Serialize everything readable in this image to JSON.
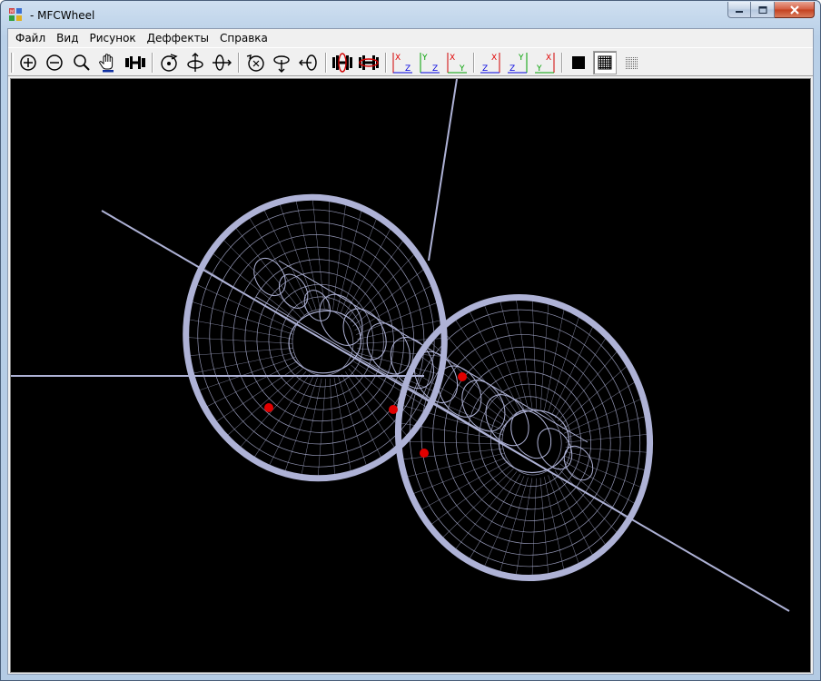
{
  "window": {
    "title": "- MFCWheel",
    "app_icon": "mfc-app-icon",
    "controls": [
      "minimize-icon",
      "maximize-icon",
      "close-icon"
    ]
  },
  "menubar": {
    "items": [
      {
        "label": "Файл"
      },
      {
        "label": "Вид"
      },
      {
        "label": "Рисунок"
      },
      {
        "label": "Деффекты"
      },
      {
        "label": "Справка"
      }
    ]
  },
  "toolbar": {
    "groups": [
      [
        "zoom-in-icon",
        "zoom-out-icon",
        "magnifier-icon",
        "pan-hand-icon",
        "fit-icon"
      ],
      [
        "rotate-x-icon",
        "rotate-y-icon",
        "rotate-z-icon"
      ],
      [
        "rotate-free-icon",
        "rotate-vertical-icon",
        "rotate-horizontal-icon"
      ],
      [
        "wheel-flip-left-icon",
        "wheel-flip-right-icon"
      ],
      [
        "view-xz-icon",
        "view-yz-icon",
        "view-xy-icon"
      ],
      [
        "view-zx-icon",
        "view-zy-icon",
        "view-yx-icon"
      ],
      [
        "solid-render-icon",
        "wireframe-render-icon",
        "points-render-icon"
      ]
    ],
    "axis_views": [
      {
        "top": "X",
        "bottom": "Z",
        "top_color": "#e00000",
        "bottom_color": "#0000e0"
      },
      {
        "top": "Y",
        "bottom": "Z",
        "top_color": "#00b000",
        "bottom_color": "#0000e0"
      },
      {
        "top": "X",
        "bottom": "Y",
        "top_color": "#e00000",
        "bottom_color": "#00b000"
      },
      {
        "top": "X",
        "bottom": "Z",
        "top_color": "#e00000",
        "bottom_color": "#0000e0"
      },
      {
        "top": "Y",
        "bottom": "Z",
        "top_color": "#00b000",
        "bottom_color": "#0000e0"
      },
      {
        "top": "X",
        "bottom": "Y",
        "top_color": "#e00000",
        "bottom_color": "#00b000"
      }
    ],
    "active_render_mode": "wireframe-render-icon"
  },
  "scene": {
    "background": "#000000",
    "mesh_color": "#aeb2d6",
    "marker_color": "#e00000",
    "defect_markers": 4
  }
}
